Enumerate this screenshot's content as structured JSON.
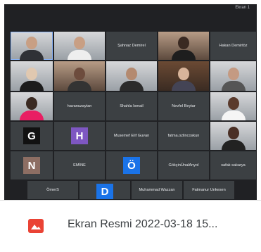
{
  "status_time": "Ekran 1",
  "tiles": {
    "sahnaz": "Şahnaz Demirel",
    "hakan": "Hakan Demirtöz",
    "havanu": "havanuzaytan",
    "shahla": "Shahla Ismail",
    "nevfel": "Nevfel Beytar",
    "g_letter": "G",
    "h_letter": "H",
    "musemef": "Musemef Elif Guvan",
    "fatma": "fatma.ozlincoskun",
    "n_letter": "N",
    "emine": "EMİNE",
    "o_letter": "Ö",
    "gokcin": "GökçinÜnalAnyol",
    "safak": "safak sakarya",
    "omer": "ÖmerS",
    "d_letter": "D",
    "muhammad": "Muhammad Wazzan",
    "fatmanur": "Fatmanur Unkesen"
  },
  "file": {
    "icon": "image-file-icon",
    "name": "Ekran Resmi 2022-03-18 15...",
    "icon_color": "#ea4335"
  }
}
